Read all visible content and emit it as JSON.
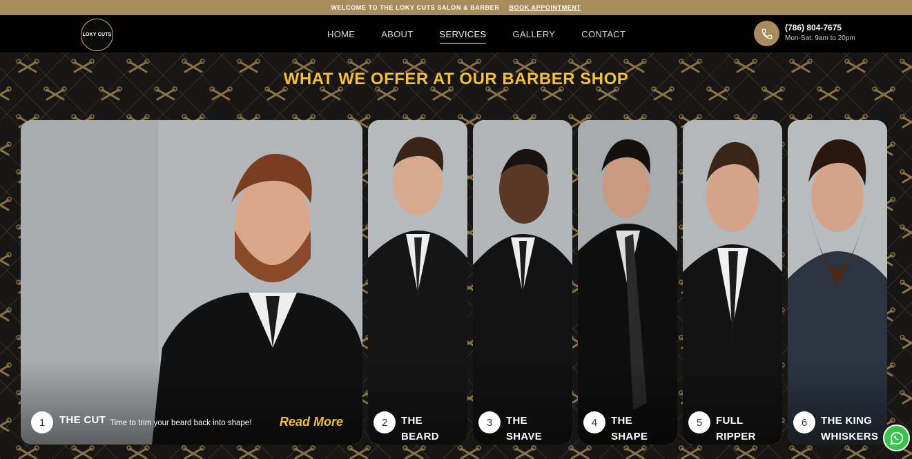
{
  "topbar": {
    "welcome": "WELCOME TO THE LOKY CUTS SALON & BARBER",
    "book": "BOOK APPOINTMENT"
  },
  "header": {
    "logo_text": "LOKY CUTS",
    "nav": [
      "HOME",
      "ABOUT",
      "SERVICES",
      "GALLERY",
      "CONTACT"
    ],
    "active_nav": "SERVICES",
    "phone": "(786) 804-7675",
    "hours": "Mon-Sat: 9am to 20pm"
  },
  "section": {
    "heading": "WHAT WE OFFER AT OUR BARBER SHOP"
  },
  "services": [
    {
      "number": "1",
      "title": "THE CUT",
      "description": "Time to trim your beard back into shape!",
      "cta": "Read More"
    },
    {
      "number": "2",
      "title": "THE\nBEARD"
    },
    {
      "number": "3",
      "title": "THE\nSHAVE"
    },
    {
      "number": "4",
      "title": "THE\nSHAPE"
    },
    {
      "number": "5",
      "title": "FULL\nRIPPER"
    },
    {
      "number": "6",
      "title": "THE KING\nWHISKERS"
    }
  ],
  "colors": {
    "gold": "#a88c5c",
    "heading_yellow": "#f2c035",
    "whatsapp_green": "#3cc04e"
  },
  "icons": [
    "phone-icon",
    "whatsapp-icon",
    "scissors-razor-motif"
  ]
}
